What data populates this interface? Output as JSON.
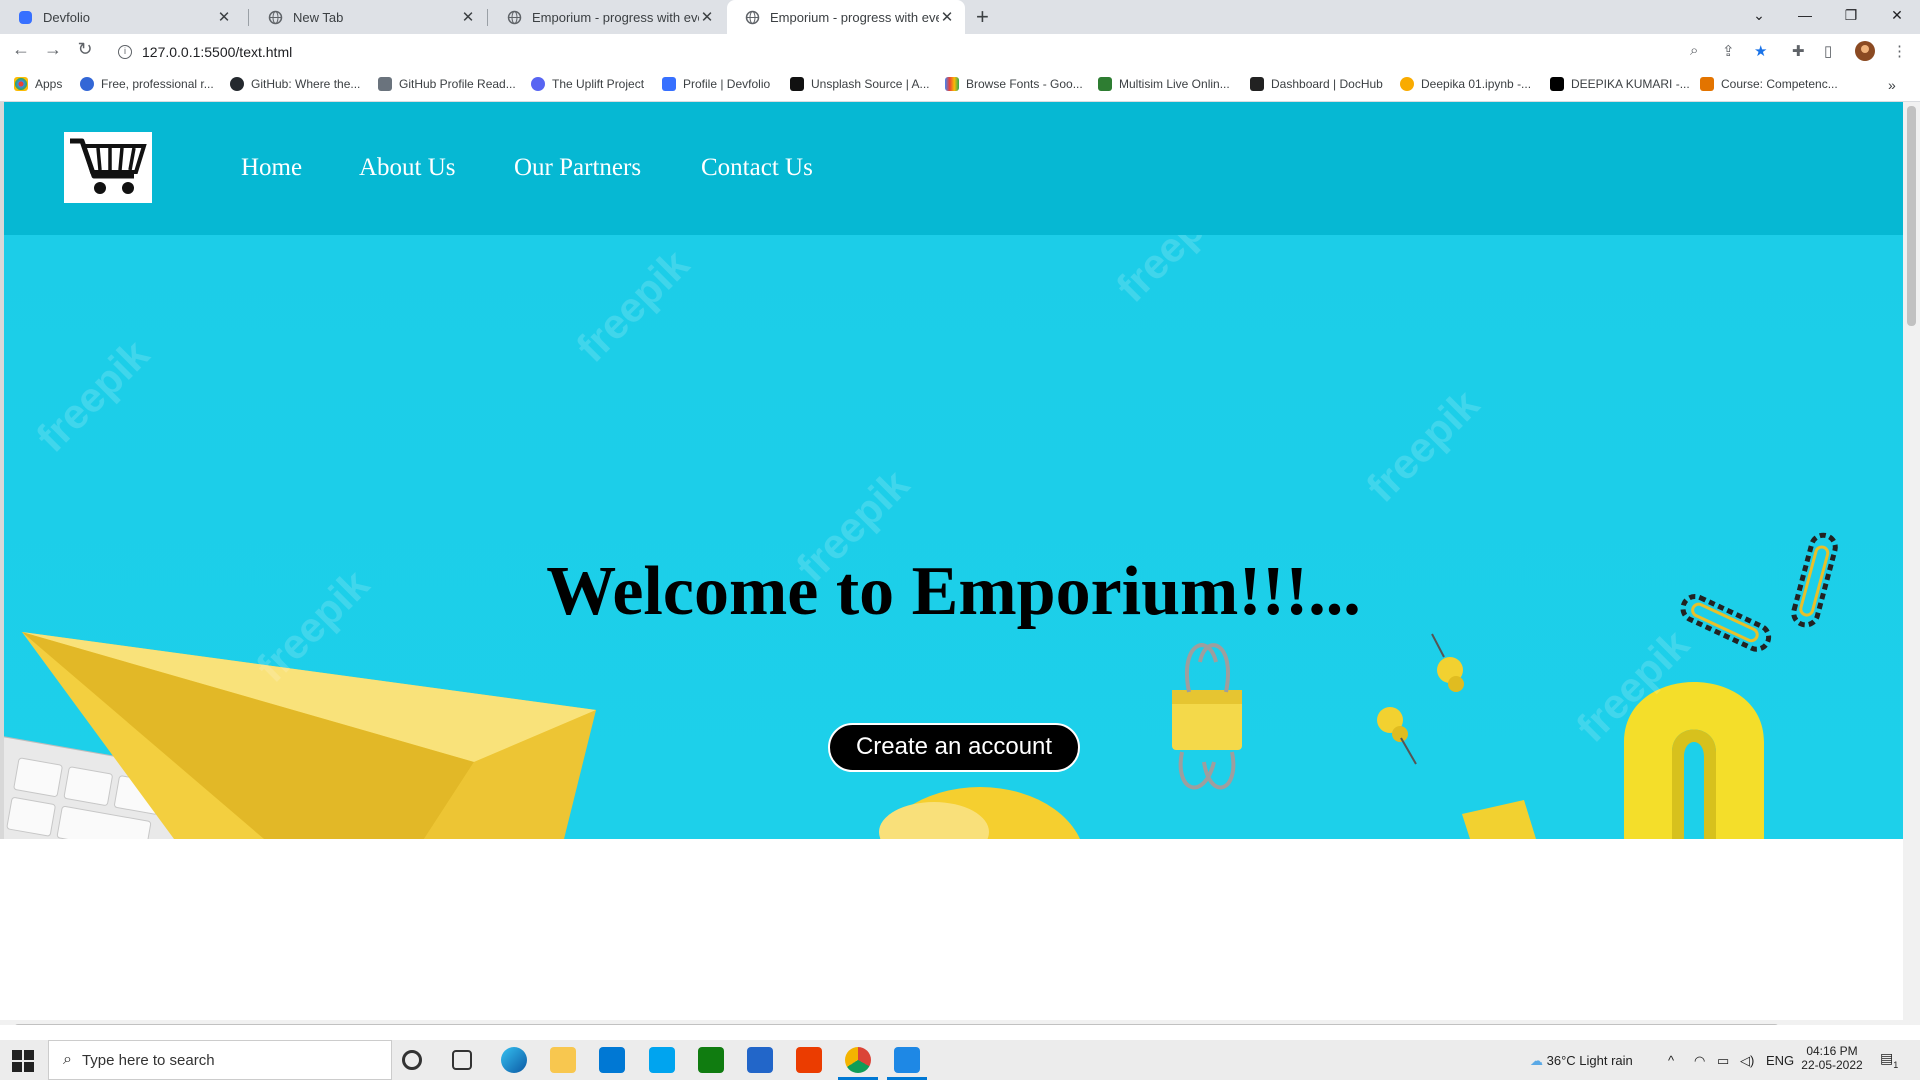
{
  "browser": {
    "tabs": [
      {
        "title": "Devfolio"
      },
      {
        "title": "New Tab"
      },
      {
        "title": "Emporium - progress with every"
      },
      {
        "title": "Emporium - progress with every"
      }
    ],
    "url": "127.0.0.1:5500/text.html",
    "bookmarks": [
      {
        "label": "Apps",
        "color": "#ea4335"
      },
      {
        "label": "Free, professional r...",
        "color": "#3367d6"
      },
      {
        "label": "GitHub: Where the...",
        "color": "#24292e"
      },
      {
        "label": "GitHub Profile Read...",
        "color": "#6a737d"
      },
      {
        "label": "The Uplift Project",
        "color": "#5865f2"
      },
      {
        "label": "Profile | Devfolio",
        "color": "#3770ff"
      },
      {
        "label": "Unsplash Source | A...",
        "color": "#111111"
      },
      {
        "label": "Browse Fonts - Goo...",
        "color": "#fbbc05"
      },
      {
        "label": "Multisim Live Onlin...",
        "color": "#2e7d32"
      },
      {
        "label": "Dashboard | DocHub",
        "color": "#222222"
      },
      {
        "label": "Deepika 01.ipynb -...",
        "color": "#f9ab00"
      },
      {
        "label": "DEEPIKA KUMARI -...",
        "color": "#000000"
      },
      {
        "label": "Course: Competenc...",
        "color": "#e37400"
      }
    ]
  },
  "page": {
    "nav": {
      "links": [
        {
          "label": "Home"
        },
        {
          "label": "About Us"
        },
        {
          "label": "Our Partners"
        },
        {
          "label": "Contact Us"
        }
      ]
    },
    "hero": {
      "heading": "Welcome to Emporium!!!...",
      "cta_label": "Create an account",
      "watermark": "freepik"
    }
  },
  "taskbar": {
    "search_placeholder": "Type here to search",
    "weather": "36°C  Light rain",
    "language": "ENG",
    "time": "04:16 PM",
    "date": "22-05-2022",
    "notification_count": "1"
  },
  "colors": {
    "hero_bg": "#1dd0ea",
    "nav_bg": "#06b8d3",
    "cta_bg": "#000000",
    "accent_yellow": "#f6d03b"
  }
}
